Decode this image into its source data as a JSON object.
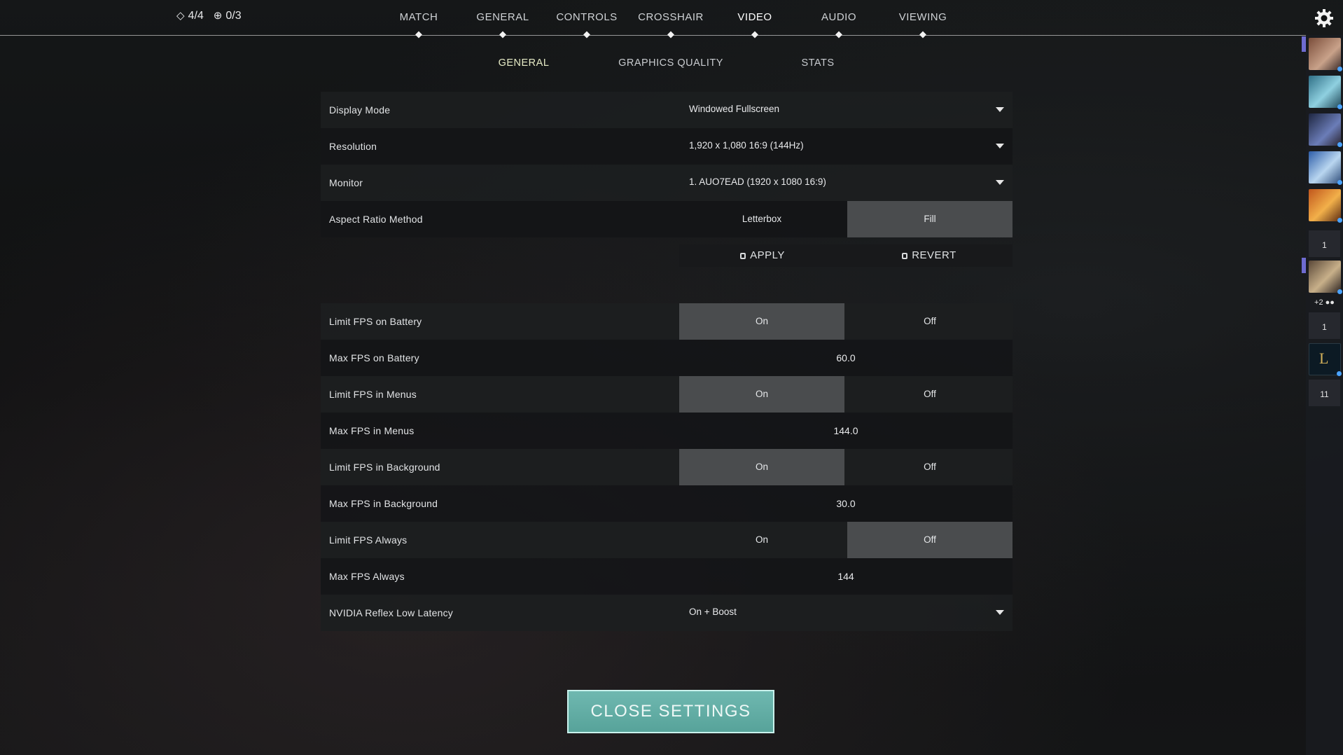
{
  "top_stats": {
    "item1_value": "4/4",
    "item2_value": "0/3"
  },
  "nav": {
    "tabs": [
      {
        "label": "MATCH"
      },
      {
        "label": "GENERAL"
      },
      {
        "label": "CONTROLS"
      },
      {
        "label": "CROSSHAIR"
      },
      {
        "label": "VIDEO",
        "active": true
      },
      {
        "label": "AUDIO"
      },
      {
        "label": "VIEWING"
      }
    ]
  },
  "subnav": {
    "tabs": [
      {
        "label": "GENERAL",
        "active": true
      },
      {
        "label": "GRAPHICS QUALITY"
      },
      {
        "label": "STATS"
      }
    ]
  },
  "settings": {
    "display_mode": {
      "label": "Display Mode",
      "value": "Windowed Fullscreen"
    },
    "resolution": {
      "label": "Resolution",
      "value": "1,920 x 1,080 16:9 (144Hz)"
    },
    "monitor": {
      "label": "Monitor",
      "value": "1. AUO7EAD (1920 x  1080 16:9)"
    },
    "aspect_ratio": {
      "label": "Aspect Ratio Method",
      "option_a": "Letterbox",
      "option_b": "Fill",
      "selected": "Fill"
    },
    "apply_label": "APPLY",
    "revert_label": "REVERT",
    "limit_fps_battery": {
      "label": "Limit FPS on Battery",
      "on": "On",
      "off": "Off",
      "selected": "On"
    },
    "max_fps_battery": {
      "label": "Max FPS on Battery",
      "value": "60.0"
    },
    "limit_fps_menus": {
      "label": "Limit FPS in Menus",
      "on": "On",
      "off": "Off",
      "selected": "On"
    },
    "max_fps_menus": {
      "label": "Max FPS in Menus",
      "value": "144.0"
    },
    "limit_fps_background": {
      "label": "Limit FPS in Background",
      "on": "On",
      "off": "Off",
      "selected": "On"
    },
    "max_fps_background": {
      "label": "Max FPS in Background",
      "value": "30.0"
    },
    "limit_fps_always": {
      "label": "Limit FPS Always",
      "on": "On",
      "off": "Off",
      "selected": "Off"
    },
    "max_fps_always": {
      "label": "Max FPS Always",
      "value": "144"
    },
    "nvidia_reflex": {
      "label": "NVIDIA Reflex Low Latency",
      "value": "On + Boost"
    }
  },
  "close_button": "CLOSE SETTINGS",
  "sidebar": {
    "count_1": "1",
    "party_extra": "+2",
    "count_2": "1",
    "count_3": "11"
  },
  "colors": {
    "accent": "#6fb8b0",
    "selected_toggle": "#4a4c4e",
    "status_dot": "#4aa3ff"
  }
}
